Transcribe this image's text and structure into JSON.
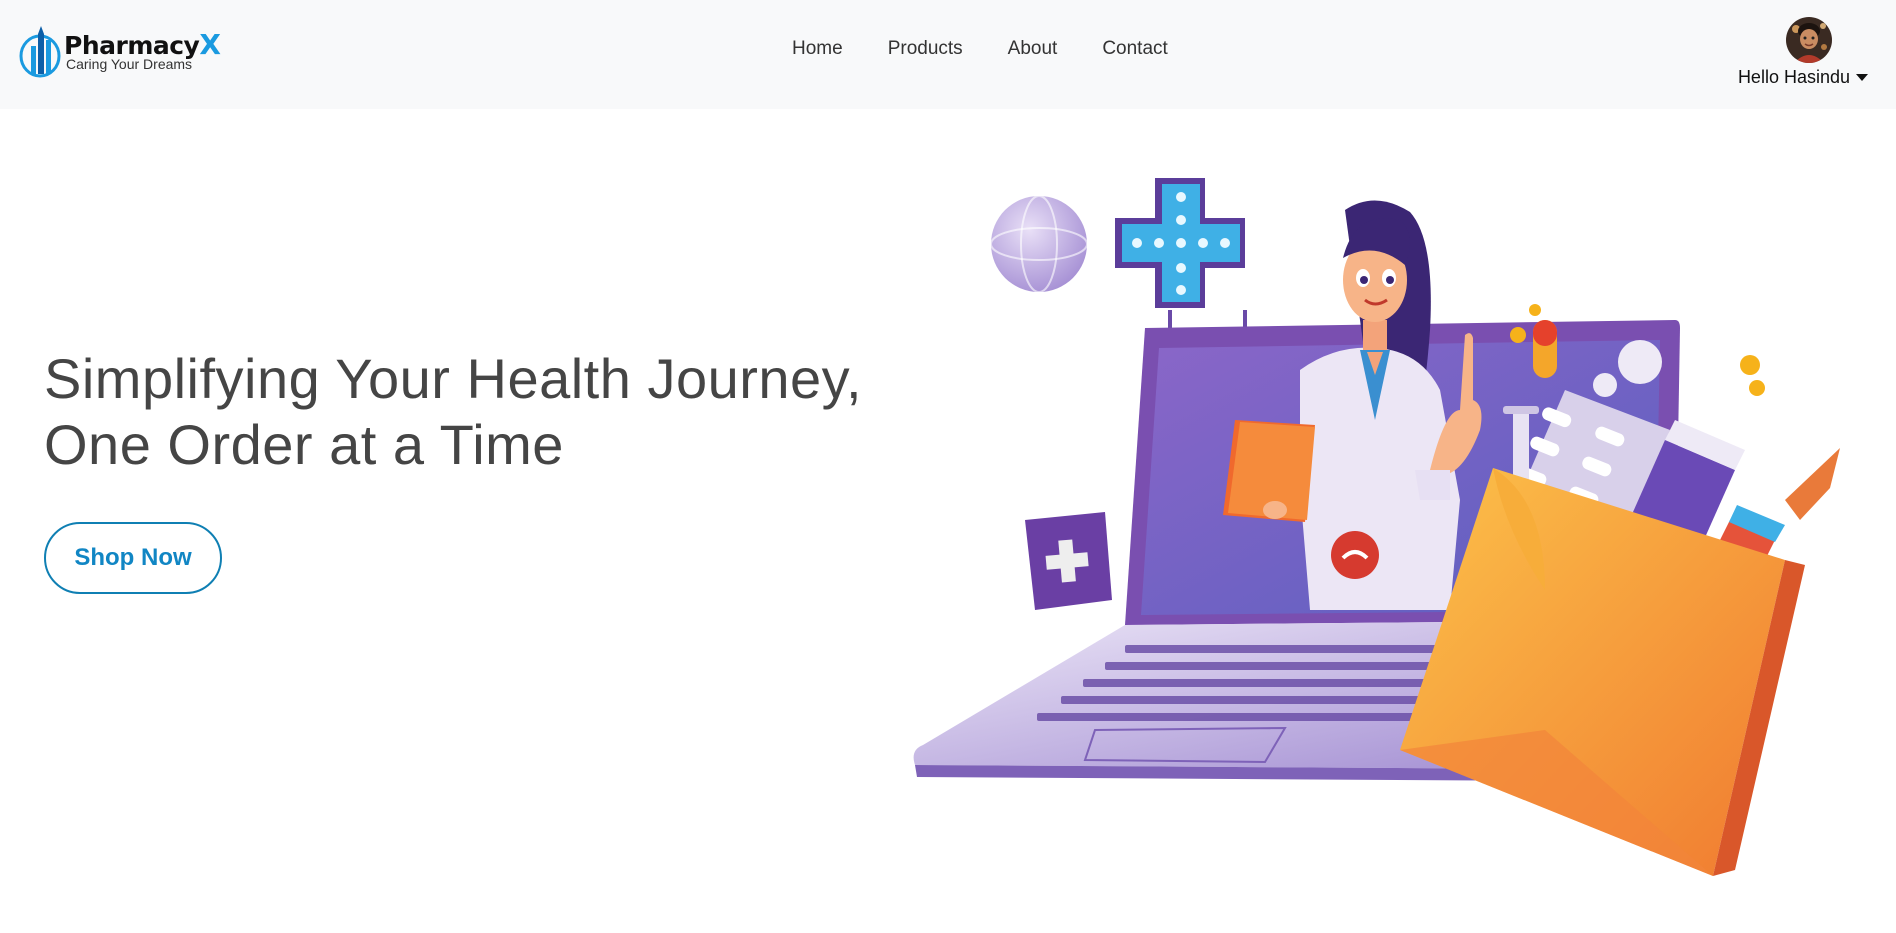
{
  "brand": {
    "name": "Pharmacy",
    "name_accent": "X",
    "tagline": "Caring Your Dreams"
  },
  "nav": {
    "items": [
      {
        "label": "Home"
      },
      {
        "label": "Products"
      },
      {
        "label": "About"
      },
      {
        "label": "Contact"
      }
    ]
  },
  "user": {
    "greeting": "Hello Hasindu",
    "avatar_icon": "avatar-icon",
    "dropdown_icon": "caret-down-icon"
  },
  "hero": {
    "title_line1": "Simplifying Your Health Journey,",
    "title_line2": "One Order at a Time",
    "cta_label": "Shop Now"
  },
  "colors": {
    "accent": "#1a9ae0",
    "cta_border": "#0f7fb3",
    "laptop_purple": "#7a4fb0",
    "bag_orange": "#f59a3a",
    "navbar_bg": "#f8f9fa"
  }
}
